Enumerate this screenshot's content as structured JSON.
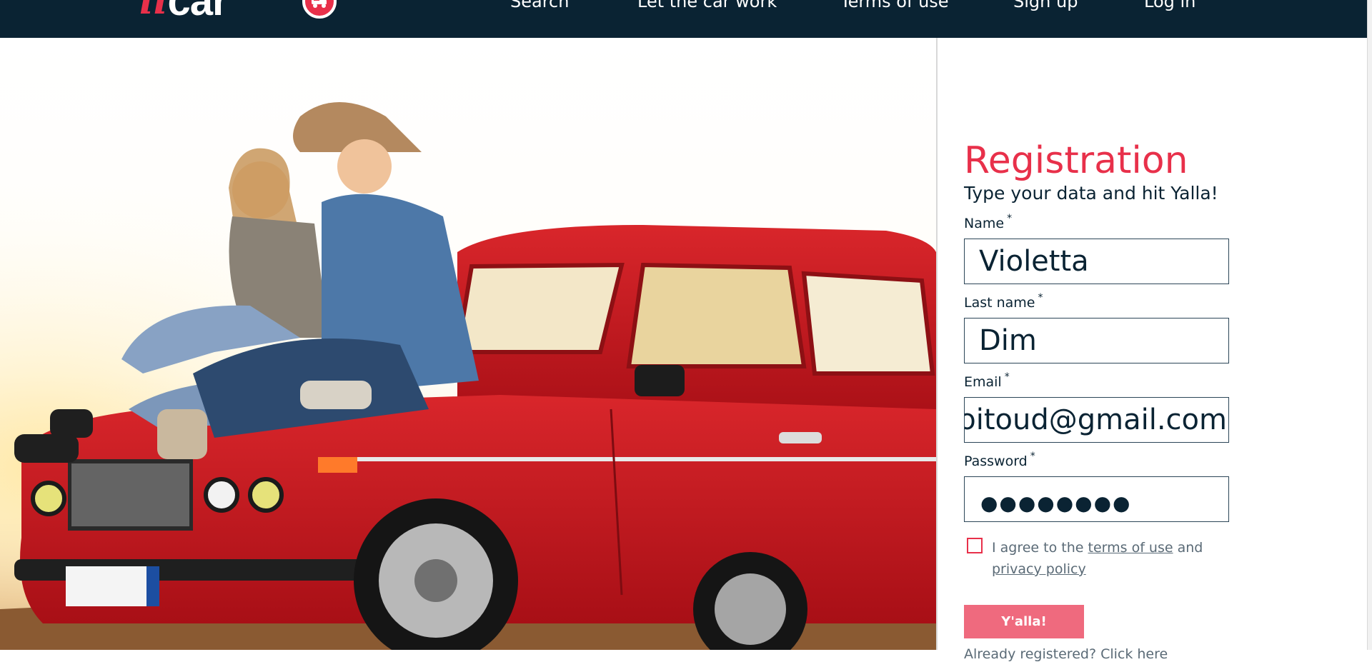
{
  "header": {
    "logo_prefix": "ii",
    "logo_word": "car",
    "nav": [
      "Search",
      "Let the car work",
      "Terms of use",
      "Sign up",
      "Log in"
    ]
  },
  "form": {
    "title": "Registration",
    "subtitle": "Type your data and hit Yalla!",
    "required_mark": "*",
    "fields": [
      {
        "label": "Name",
        "value": "Violetta"
      },
      {
        "label": "Last name",
        "value": "Dim"
      },
      {
        "label": "Email",
        "value": "voitoud@gmail.com"
      },
      {
        "label": "Password",
        "value": "●●●●●●●●"
      }
    ],
    "agree_text_1": "I agree to the ",
    "terms_link": "terms of use",
    "agree_text_2": " and ",
    "privacy_link": "privacy policy",
    "checkbox_checked": false,
    "submit_label": "Y'alla!",
    "already_registered": "Already registered? Click here"
  },
  "colors": {
    "header_bg": "#0a2333",
    "accent": "#e8304a",
    "button": "#ef6a7e",
    "car_red": "#c4161c"
  },
  "hero_image": "photo-couple-on-red-car-icon"
}
